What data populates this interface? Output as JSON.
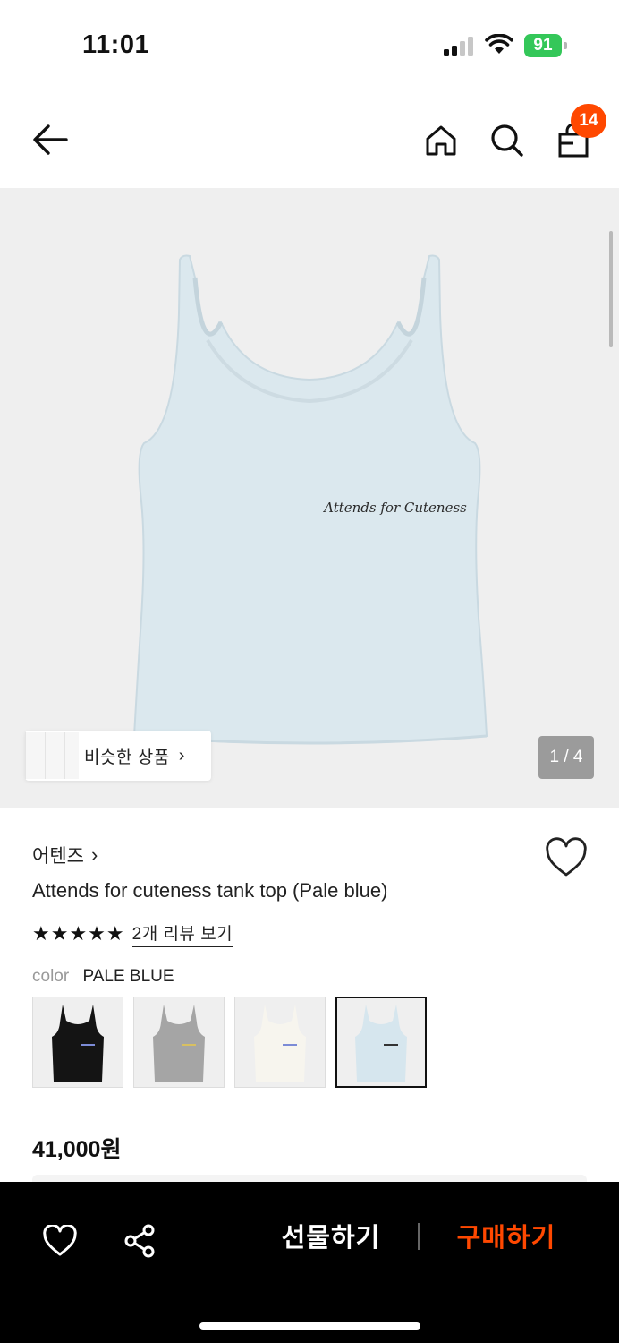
{
  "status_bar": {
    "time": "11:01",
    "battery": "91"
  },
  "nav": {
    "back_icon": "arrow-left-icon",
    "home_icon": "home-icon",
    "search_icon": "search-icon",
    "cart_icon": "shopping-bag-icon",
    "cart_count": "14",
    "accent_color": "#ff4800"
  },
  "gallery": {
    "print_text": "Attends for Cuteness",
    "similar_label": "비슷한 상품",
    "similar_chevron": "›",
    "page_indicator": "1 / 4"
  },
  "product": {
    "brand": "어텐즈",
    "brand_chevron": "›",
    "title": "Attends for cuteness tank top (Pale blue)",
    "stars": "★★★★★",
    "rating": 5,
    "review_link": "2개 리뷰 보기",
    "color_label": "color",
    "color_value": "PALE BLUE",
    "swatches": [
      {
        "name": "black",
        "color": "#141414"
      },
      {
        "name": "grey",
        "color": "#a5a5a5"
      },
      {
        "name": "ivory",
        "color": "#f7f5ee"
      },
      {
        "name": "pale-blue",
        "color": "#d6e6ee",
        "selected": true
      }
    ],
    "price": "41,000원"
  },
  "bottom_bar": {
    "like_icon": "heart-icon",
    "share_icon": "share-icon",
    "gift_label": "선물하기",
    "buy_label": "구매하기",
    "buy_color": "#ff4800"
  }
}
